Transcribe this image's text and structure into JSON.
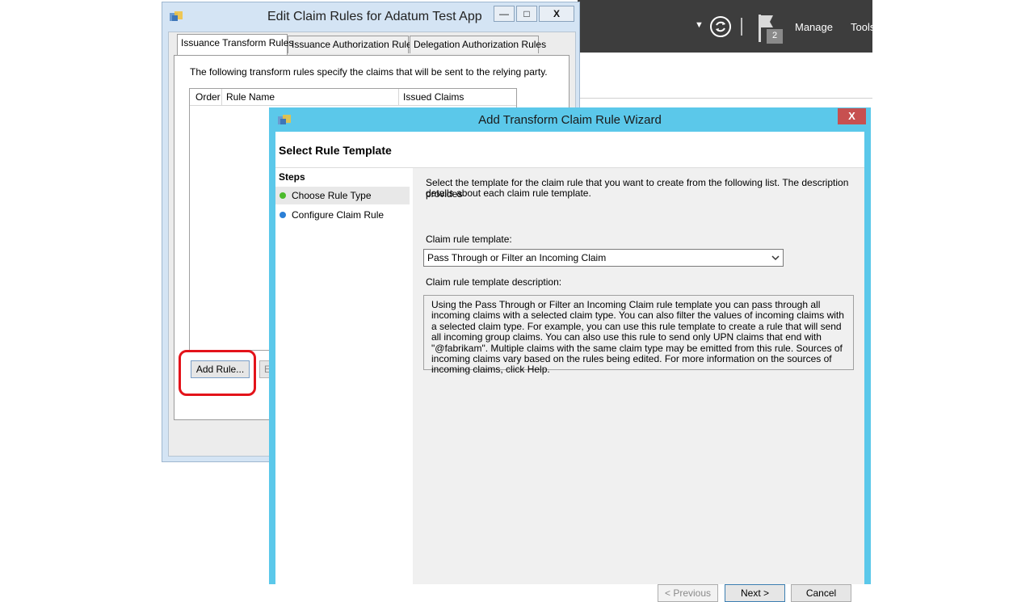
{
  "server_manager": {
    "menu": [
      "Manage",
      "Tools"
    ],
    "flag_badge": "2"
  },
  "claim_rules_dialog": {
    "title": "Edit Claim Rules for Adatum Test App",
    "window_buttons": {
      "minimize": "—",
      "maximize": "□",
      "close": "X"
    },
    "tabs": [
      "Issuance Transform Rules",
      "Issuance Authorization Rules",
      "Delegation Authorization Rules"
    ],
    "description": "The following transform rules specify the claims that will be sent to the relying party.",
    "columns": [
      "Order",
      "Rule Name",
      "Issued Claims"
    ],
    "add_rule_label": "Add Rule...",
    "edit_rule_partial": "E"
  },
  "wizard": {
    "title": "Add Transform Claim Rule Wizard",
    "close_label": "X",
    "header": "Select Rule Template",
    "steps_title": "Steps",
    "steps": [
      {
        "label": "Choose Rule Type",
        "color": "#4cbb2c"
      },
      {
        "label": "Configure Claim Rule",
        "color": "#2b7fd6"
      }
    ],
    "intro_line1": "Select the template for the claim rule that you want to create from the following list. The description provides",
    "intro_line2": "details about each claim rule template.",
    "template_label": "Claim rule template:",
    "template_value": "Pass Through or Filter an Incoming Claim",
    "description_label": "Claim rule template description:",
    "description_text": "Using the Pass Through or Filter an Incoming Claim rule template you can pass through all incoming claims with a selected claim type.  You can also filter the values of incoming claims with a selected claim type.  For example, you can use this rule template to create a rule that will send all incoming group claims.  You can also use this rule to send only UPN claims that end with \"@fabrikam\".  Multiple claims with the same claim type may be emitted from this rule.  Sources of incoming claims vary based on the rules being edited.  For more information on the sources of incoming claims, click Help.",
    "buttons": {
      "previous": "< Previous",
      "next": "Next >",
      "cancel": "Cancel"
    }
  }
}
